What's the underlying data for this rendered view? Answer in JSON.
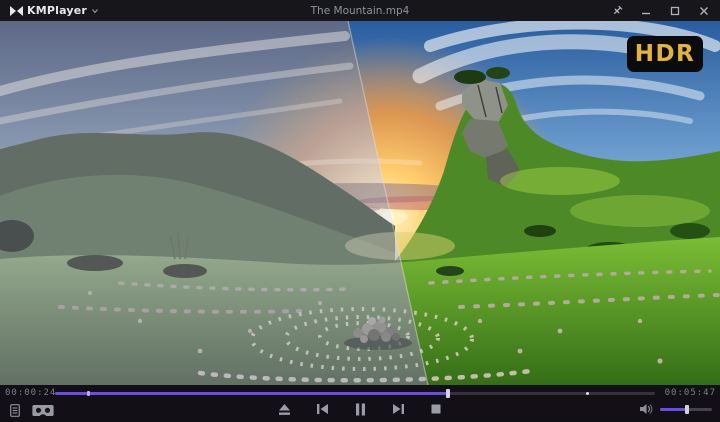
{
  "titlebar": {
    "app_name": "KMPlayer",
    "menu_chevron": "open app menu",
    "title": "The Mountain.mp4",
    "window_controls": [
      "pin-on-top",
      "minimize",
      "maximize",
      "close"
    ]
  },
  "video": {
    "hdr_badge_label": "HDR",
    "description": "Green glen at sunset, split comparison: muted SDR on the left of the diagonal, vivid HDR on the right"
  },
  "transport": {
    "elapsed": "00:00:24",
    "duration": "00:05:47",
    "progress_percent": 65.5,
    "marker_a_percent": 5.5,
    "marker_b_percent": 88.7,
    "buttons": [
      "eject",
      "previous",
      "pause",
      "next",
      "stop"
    ]
  },
  "side_controls": [
    "playlist",
    "vr-mode"
  ],
  "volume": {
    "level_percent": 52,
    "icon": "speaker"
  },
  "colors": {
    "accent_purple": "#6a4fd8",
    "hdr_gold": "#e2b43e",
    "titlebar_bg": "#16161b",
    "controlbar_bg": "#121016",
    "icon_gray": "#9b9ba3"
  }
}
